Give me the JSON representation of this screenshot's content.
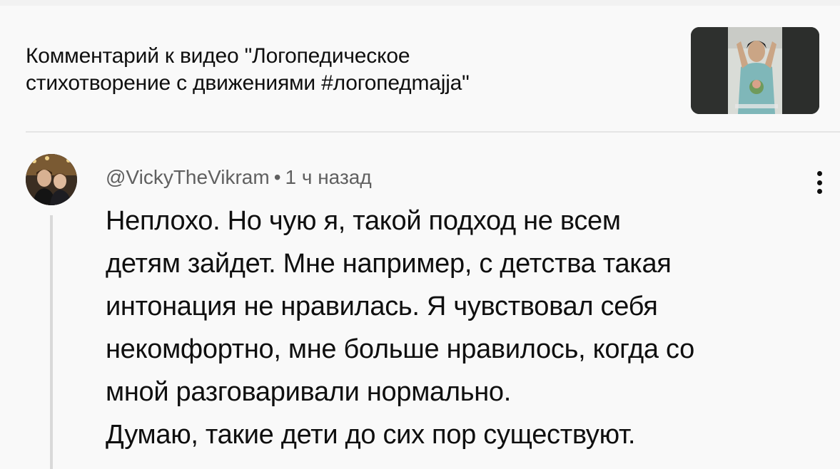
{
  "header": {
    "title_line1": "Комментарий к видео \"Логопедическое",
    "title_line2": "стихотворение с движениями #логопедmajja\"",
    "thumbnail_icon": "video-thumbnail-icon"
  },
  "comment": {
    "author": "@VickyTheVikram",
    "separator": "•",
    "time": "1 ч назад",
    "text_lines": [
      "Неплохо. Но чую я, такой подход не всем",
      "детям зайдет. Мне например, с детства такая",
      "интонация не нравилась. Я чувствовал себя",
      "некомфортно, мне больше нравилось, когда со",
      "мной разговаривали нормально.",
      "Думаю, такие дети до сих пор существуют."
    ],
    "more_icon": "more-vertical-icon",
    "avatar_icon": "user-avatar-icon"
  },
  "colors": {
    "background": "#f9f9f9",
    "text_primary": "#0f0f0f",
    "text_secondary": "#606060",
    "divider": "#e5e5e5"
  }
}
